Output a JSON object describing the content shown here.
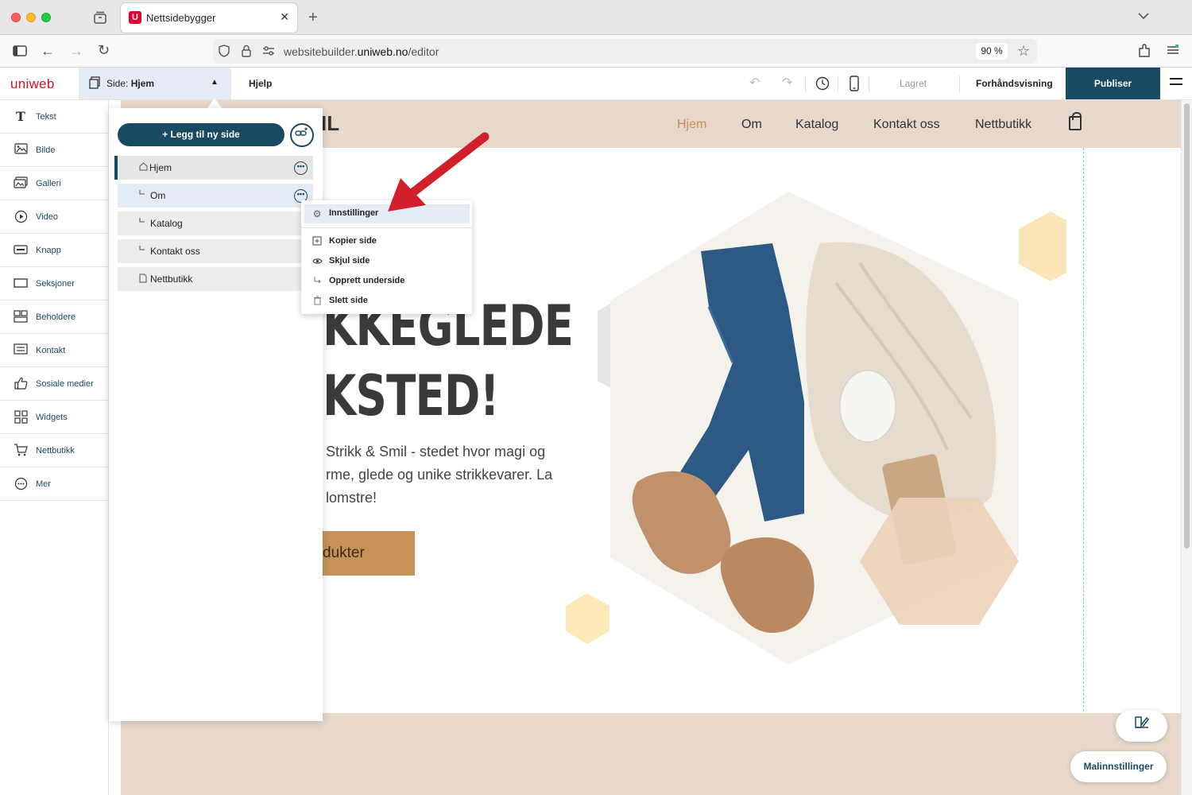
{
  "browser": {
    "tab_title": "Nettsidebygger",
    "tab_favicon_letter": "U",
    "url_prefix": "websitebuilder.",
    "url_domain": "uniweb.no",
    "url_path": "/editor",
    "zoom": "90 %"
  },
  "app": {
    "logo": "uniweb",
    "page_select_prefix": "Side: ",
    "page_select_value": "Hjem",
    "help": "Hjelp",
    "saved": "Lagret",
    "preview": "Forhåndsvisning",
    "publish": "Publiser"
  },
  "tools": [
    {
      "label": "Tekst",
      "icon": "text-icon"
    },
    {
      "label": "Bilde",
      "icon": "image-icon"
    },
    {
      "label": "Galleri",
      "icon": "gallery-icon"
    },
    {
      "label": "Video",
      "icon": "video-icon"
    },
    {
      "label": "Knapp",
      "icon": "button-icon"
    },
    {
      "label": "Seksjoner",
      "icon": "sections-icon"
    },
    {
      "label": "Beholdere",
      "icon": "containers-icon"
    },
    {
      "label": "Kontakt",
      "icon": "contact-icon"
    },
    {
      "label": "Sosiale medier",
      "icon": "thumbs-up-icon"
    },
    {
      "label": "Widgets",
      "icon": "widgets-icon"
    },
    {
      "label": "Nettbutikk",
      "icon": "cart-icon"
    },
    {
      "label": "Mer",
      "icon": "more-icon"
    }
  ],
  "pages_panel": {
    "add_page": "+ Legg til ny side",
    "pages": [
      {
        "label": "Hjem"
      },
      {
        "label": "Om"
      },
      {
        "label": "Katalog"
      },
      {
        "label": "Kontakt oss"
      },
      {
        "label": "Nettbutikk"
      }
    ]
  },
  "context_menu": {
    "items": [
      {
        "label": "Innstillinger",
        "icon": "gear-icon"
      },
      {
        "label": "Kopier side",
        "icon": "copy-icon"
      },
      {
        "label": "Skjul side",
        "icon": "eye-icon"
      },
      {
        "label": "Opprett underside",
        "icon": "subpage-icon"
      },
      {
        "label": "Slett side",
        "icon": "trash-icon"
      }
    ]
  },
  "site": {
    "logo_fragment": "IL",
    "nav": [
      "Hjem",
      "Om",
      "Katalog",
      "Kontakt oss",
      "Nettbutikk"
    ],
    "nav_active_color": "#c69257",
    "heading_line1": "KKEGLEDE",
    "heading_line2": "KSTED!",
    "text_line1": "Strikk & Smil - stedet hvor magi og",
    "text_line2": "rme, glede og unike strikkevarer. La",
    "text_line3": "lomstre!",
    "button": "dukter"
  },
  "floating": {
    "template_settings": "Malinnstillinger"
  },
  "colors": {
    "brand": "#1a4a63",
    "logo_red": "#d4152c",
    "site_beige": "#e7d8cb",
    "accent_tan": "#c69257"
  }
}
